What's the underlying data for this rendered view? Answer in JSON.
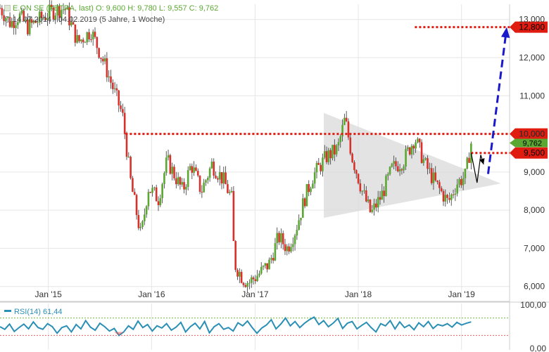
{
  "legend": {
    "instrument_line": "E.ON SE (XETRA, last)  O: 9,600  H: 9,780  L: 9,557  C: 9,762",
    "range_line": "14.07.2014 - 04.02.2019    (5 Jahre, 1 Woche)",
    "rsi_line": "RSI(14)  61,44"
  },
  "colors": {
    "up": "#5aa832",
    "down": "#d9302a",
    "resistance": "#e01b10",
    "target_arrow": "#1a1acc",
    "triangle": "#d9d9d9",
    "rsi_line": "#2a8fb5",
    "grid": "#e6e6e6"
  },
  "chart_data": [
    {
      "type": "candlestick",
      "name": "E.ON SE",
      "x_ticks": [
        "Jan '15",
        "Jan '16",
        "Jan '17",
        "Jan '18",
        "Jan '19"
      ],
      "y_ticks": [
        "6,000",
        "7,000",
        "8,000",
        "9,000",
        "10,000",
        "11,000",
        "12,000",
        "13,000"
      ],
      "ylim": [
        5.7,
        13.4
      ],
      "xlim": [
        "2014-07-14",
        "2019-06-20"
      ],
      "grid": true,
      "current_price": {
        "value": 9.762,
        "label": "9,762"
      },
      "levels": [
        {
          "value": 12.8,
          "label": "12,800",
          "x_from": "2018-07-20"
        },
        {
          "value": 10.0,
          "label": "10,000",
          "x_from": "2015-10-01"
        },
        {
          "value": 9.5,
          "label": "9,500",
          "x_from": "2019-02-04"
        }
      ],
      "triangle": [
        {
          "date": "2017-09-01",
          "value": 10.55
        },
        {
          "date": "2017-09-01",
          "value": 7.8
        },
        {
          "date": "2019-05-20",
          "value": 8.7
        }
      ],
      "zigzag": [
        {
          "date": "2019-02-04",
          "value": 9.5
        },
        {
          "date": "2019-02-25",
          "value": 8.72
        },
        {
          "date": "2019-03-10",
          "value": 9.45
        },
        {
          "date": "2019-03-20",
          "value": 9.2
        }
      ],
      "target_arrow": [
        {
          "date": "2019-04-05",
          "value": 8.95
        },
        {
          "date": "2019-06-10",
          "value": 12.8
        }
      ],
      "waypoints": [
        [
          "2014-07-14",
          13.3
        ],
        [
          "2014-08-20",
          12.9
        ],
        [
          "2014-09-20",
          13.1
        ],
        [
          "2014-10-20",
          12.8
        ],
        [
          "2014-12-01",
          13.0
        ],
        [
          "2015-01-10",
          13.2
        ],
        [
          "2015-03-01",
          13.3
        ],
        [
          "2015-04-15",
          12.4
        ],
        [
          "2015-06-01",
          12.7
        ],
        [
          "2015-07-20",
          11.8
        ],
        [
          "2015-09-20",
          10.5
        ],
        [
          "2015-10-20",
          8.7
        ],
        [
          "2015-11-25",
          7.3
        ],
        [
          "2015-12-20",
          8.6
        ],
        [
          "2016-01-25",
          8.3
        ],
        [
          "2016-02-25",
          9.3
        ],
        [
          "2016-04-20",
          8.5
        ],
        [
          "2016-05-20",
          9.2
        ],
        [
          "2016-06-25",
          8.5
        ],
        [
          "2016-08-01",
          9.2
        ],
        [
          "2016-09-10",
          8.8
        ],
        [
          "2016-10-10",
          8.3
        ],
        [
          "2016-10-20",
          6.6
        ],
        [
          "2016-11-20",
          6.2
        ],
        [
          "2016-12-10",
          6.1
        ],
        [
          "2017-01-25",
          6.4
        ],
        [
          "2017-02-20",
          6.6
        ],
        [
          "2017-03-25",
          7.3
        ],
        [
          "2017-04-25",
          7.0
        ],
        [
          "2017-05-25",
          7.5
        ],
        [
          "2017-06-25",
          8.3
        ],
        [
          "2017-07-25",
          8.9
        ],
        [
          "2017-09-10",
          9.4
        ],
        [
          "2017-10-20",
          9.6
        ],
        [
          "2017-11-15",
          10.4
        ],
        [
          "2017-12-10",
          9.4
        ],
        [
          "2018-01-15",
          8.5
        ],
        [
          "2018-02-15",
          7.9
        ],
        [
          "2018-03-25",
          8.4
        ],
        [
          "2018-05-01",
          9.1
        ],
        [
          "2018-06-10",
          9.3
        ],
        [
          "2018-07-20",
          9.9
        ],
        [
          "2018-08-25",
          9.2
        ],
        [
          "2018-10-01",
          8.7
        ],
        [
          "2018-11-15",
          8.2
        ],
        [
          "2018-12-15",
          8.7
        ],
        [
          "2019-01-15",
          8.9
        ],
        [
          "2019-02-04",
          9.76
        ]
      ]
    },
    {
      "type": "line",
      "name": "RSI(14)",
      "last_value": 61.44,
      "y_ticks": [
        "100,00",
        "0,00"
      ],
      "ylim": [
        0,
        100
      ],
      "reference_lines": [
        70,
        30
      ],
      "values": [
        50,
        44,
        56,
        39,
        48,
        56,
        45,
        61,
        48,
        44,
        57,
        50,
        35,
        48,
        52,
        38,
        55,
        45,
        64,
        49,
        42,
        58,
        50,
        40,
        46,
        30,
        38,
        52,
        44,
        63,
        48,
        55,
        40,
        52,
        47,
        57,
        42,
        49,
        60,
        38,
        50,
        58,
        45,
        62,
        36,
        50,
        57,
        44,
        48,
        40,
        59,
        52,
        63,
        48,
        35,
        47,
        54,
        66,
        45,
        56,
        70,
        52,
        62,
        48,
        58,
        66,
        72,
        55,
        64,
        50,
        58,
        69,
        46,
        58,
        62,
        45,
        53,
        60,
        48,
        38,
        57,
        52,
        64,
        45,
        61,
        48,
        54,
        43,
        59,
        50,
        62,
        46,
        55,
        52,
        57,
        49,
        60,
        54,
        58,
        61
      ]
    }
  ]
}
